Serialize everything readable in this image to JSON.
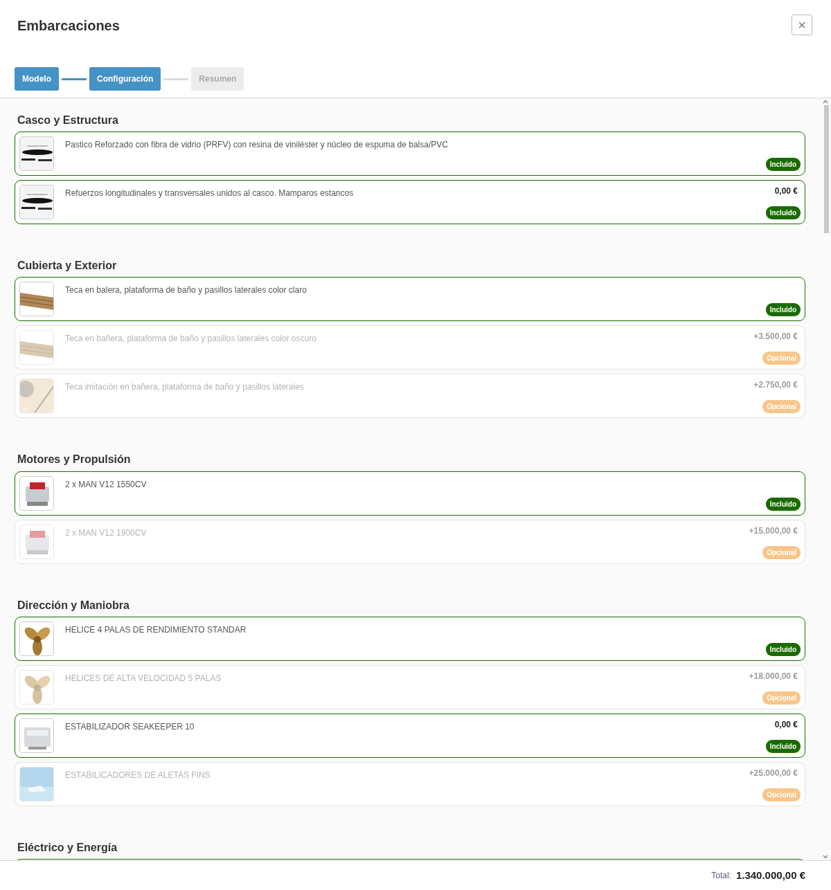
{
  "title": "Embarcaciones",
  "close_label": "×",
  "steps": [
    {
      "label": "Modelo",
      "reached": true
    },
    {
      "label": "Configuración",
      "reached": true
    },
    {
      "label": "Resumen",
      "reached": false
    }
  ],
  "sections": [
    {
      "title": "Casco y Estructura",
      "items": [
        {
          "description": "Pastico Reforzado con fibra de vidrio (PRFV) con resina de viniléster y núcleo de espuma de balsa/PVC",
          "selected": true,
          "badge": "Incluido",
          "color": "#1a6b00"
        },
        {
          "description": "Refuerzos longitudinales y transversales unidos al casco. Mamparos estancos",
          "selected": true,
          "price": "0,00 €",
          "badge": "Incluido",
          "color": "#1a6b00"
        }
      ]
    },
    {
      "title": "Cubierta y Exterior",
      "items": [
        {
          "description": "Teca en balera, plataforma de baño y pasillos laterales color claro",
          "selected": true,
          "badge": "Incluido",
          "color": "#1a6b00"
        },
        {
          "description": "Teca en bañera, plataforma de baño y pasillos laterales color oscuro",
          "selected": false,
          "price": "+3.500,00 €",
          "badge": "Opcional",
          "color": "#f8c68a"
        },
        {
          "description": "Teca imitación en bañera, plataforma de baño y pasillos laterales",
          "selected": false,
          "price": "+2.750,00 €",
          "badge": "Opcional",
          "color": "#f8c68a"
        }
      ]
    },
    {
      "title": "Motores y Propulsión",
      "items": [
        {
          "description": "2 x MAN V12 1550CV",
          "selected": true,
          "badge": "Incluido",
          "color": "#1a6b00"
        },
        {
          "description": "2 x MAN V12 1900CV",
          "selected": false,
          "price": "+15.000,00 €",
          "badge": "Opcional",
          "color": "#f8c68a"
        }
      ]
    },
    {
      "title": "Dirección y Maniobra",
      "items": [
        {
          "description": "HELICE 4 PALAS DE RENDIMIENTO STANDAR",
          "selected": true,
          "badge": "Incluido",
          "color": "#1a6b00"
        },
        {
          "description": "HELICES DE ALTA VELOCIDAD 5 PALAS",
          "selected": false,
          "price": "+18.000,00 €",
          "badge": "Opcional",
          "color": "#f8c68a"
        },
        {
          "description": "ESTABILIZADOR SEAKEEPER 10",
          "selected": true,
          "price": "0,00 €",
          "badge": "Incluido",
          "color": "#1a6b00"
        },
        {
          "description": "ESTABILICADORES DE ALETAS FINS",
          "selected": false,
          "price": "+25.000,00 €",
          "badge": "Opcional",
          "color": "#f8c68a"
        }
      ]
    },
    {
      "title": "Eléctrico y Energía",
      "items": [
        {
          "selected": true
        }
      ]
    }
  ],
  "total_label": "Total:",
  "total": "1.340.000,00 €"
}
